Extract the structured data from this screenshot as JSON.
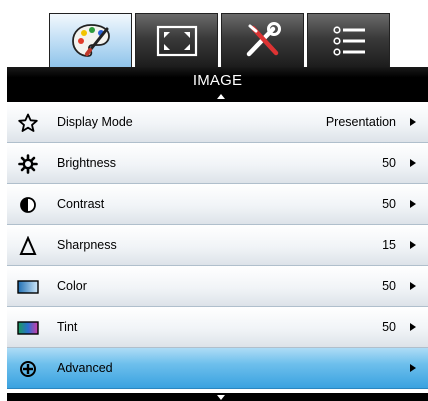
{
  "tabs": [
    {
      "icon": "palette-icon",
      "active": true
    },
    {
      "icon": "screen-resize-icon",
      "active": false
    },
    {
      "icon": "tools-icon",
      "active": false
    },
    {
      "icon": "options-list-icon",
      "active": false
    }
  ],
  "header": {
    "title": "IMAGE"
  },
  "menu": {
    "items": [
      {
        "label": "Display Mode",
        "value": "Presentation",
        "icon": "star-icon"
      },
      {
        "label": "Brightness",
        "value": "50",
        "icon": "sun-icon"
      },
      {
        "label": "Contrast",
        "value": "50",
        "icon": "contrast-icon"
      },
      {
        "label": "Sharpness",
        "value": "15",
        "icon": "sharpness-icon"
      },
      {
        "label": "Color",
        "value": "50",
        "icon": "color-icon"
      },
      {
        "label": "Tint",
        "value": "50",
        "icon": "tint-icon"
      },
      {
        "label": "Advanced",
        "value": "",
        "icon": "advanced-icon",
        "selected": true
      }
    ]
  },
  "colors": {
    "accent": "#3aa2e0",
    "header": "#000000",
    "tab_active": "#bcdcf4"
  }
}
